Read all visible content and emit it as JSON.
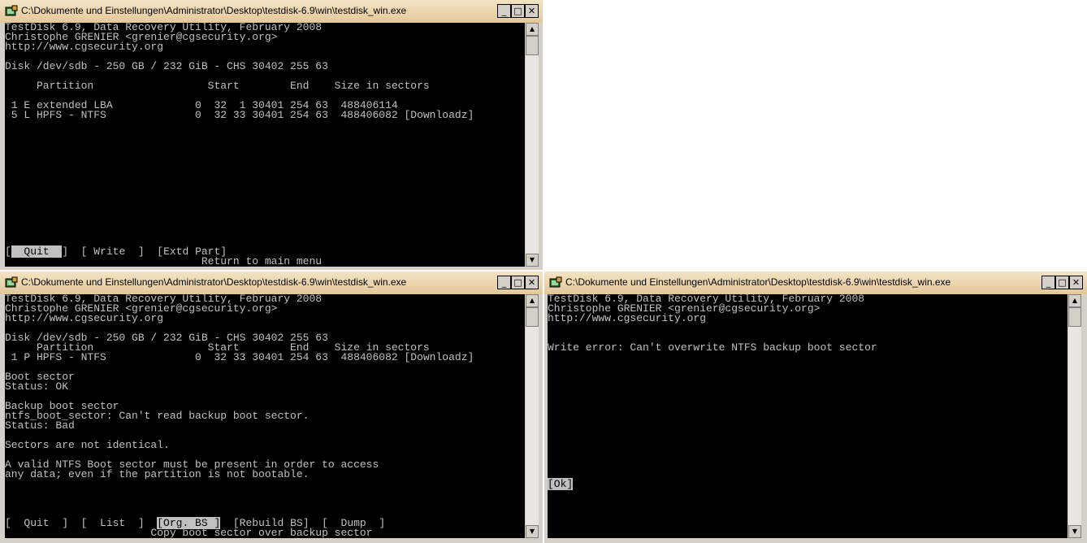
{
  "title": "C:\\Dokumente und Einstellungen\\Administrator\\Desktop\\testdisk-6.9\\win\\testdisk_win.exe",
  "caption_buttons": {
    "minimize": "_",
    "maximize": "□",
    "close": "✕"
  },
  "scroll_arrows": {
    "up": "▲",
    "down": "▼"
  },
  "window1": {
    "header": [
      "TestDisk 6.9, Data Recovery Utility, February 2008",
      "Christophe GRENIER <grenier@cgsecurity.org>",
      "http://www.cgsecurity.org"
    ],
    "disk": "Disk /dev/sdb - 250 GB / 232 GiB - CHS 30402 255 63",
    "columns": "     Partition                  Start        End    Size in sectors",
    "rows": [
      " 1 E extended LBA             0  32  1 30401 254 63  488406114",
      " 5 L HPFS - NTFS              0  32 33 30401 254 63  488406082 [Downloadz]"
    ],
    "menu": {
      "quit": "  Quit  ",
      "write": "[ Write  ]",
      "extd": "[Extd Part]"
    },
    "hint": "                               Return to main menu"
  },
  "window2": {
    "header": [
      "TestDisk 6.9, Data Recovery Utility, February 2008",
      "Christophe GRENIER <grenier@cgsecurity.org>",
      "http://www.cgsecurity.org"
    ],
    "disk": "Disk /dev/sdb - 250 GB / 232 GiB - CHS 30402 255 63",
    "columns": "     Partition                  Start        End    Size in sectors",
    "row": " 1 P HPFS - NTFS              0  32 33 30401 254 63  488406082 [Downloadz]",
    "boot_sector": "Boot sector",
    "boot_status": "Status: OK",
    "backup": "Backup boot sector",
    "backup_err": "ntfs_boot_sector: Can't read backup boot sector.",
    "backup_status": "Status: Bad",
    "not_identical": "Sectors are not identical.",
    "msg1": "A valid NTFS Boot sector must be present in order to access",
    "msg2": "any data; even if the partition is not bootable.",
    "menu": {
      "quit": "[  Quit  ]",
      "list": "[  List  ]",
      "org": "[Org. BS ]",
      "rebuild": "[Rebuild BS]",
      "dump": "[  Dump  ]"
    },
    "hint": "                       Copy boot sector over backup sector"
  },
  "window3": {
    "header": [
      "TestDisk 6.9, Data Recovery Utility, February 2008",
      "Christophe GRENIER <grenier@cgsecurity.org>",
      "http://www.cgsecurity.org"
    ],
    "error": "Write error: Can't overwrite NTFS backup boot sector",
    "ok": "[Ok]"
  }
}
